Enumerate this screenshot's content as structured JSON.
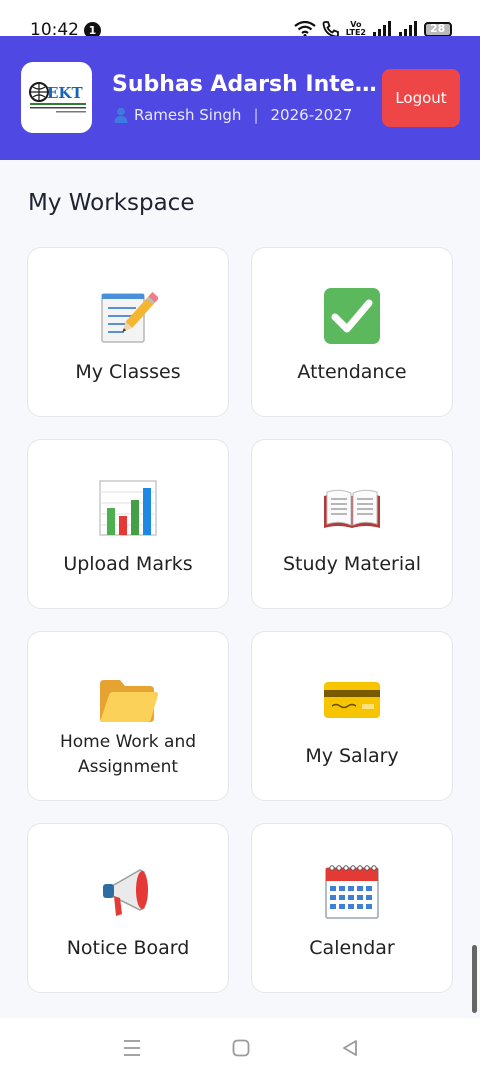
{
  "status_bar": {
    "time": "10:42",
    "notification_count": "1",
    "volte_top": "Vo",
    "volte_bottom": "LTE2",
    "battery": "28"
  },
  "header": {
    "school_name": "Subhas Adarsh Inter C...",
    "user_name": "Ramesh Singh",
    "session": "2026-2027",
    "logout_label": "Logout",
    "logo_text": "EKT",
    "colors": {
      "header_bg": "#4f48e2",
      "logout_bg": "#ee4646"
    }
  },
  "workspace": {
    "title": "My Workspace",
    "cards": [
      {
        "label": "My Classes",
        "icon": "memo-pencil-icon"
      },
      {
        "label": "Attendance",
        "icon": "check-mark-icon"
      },
      {
        "label": "Upload Marks",
        "icon": "bar-chart-icon"
      },
      {
        "label": "Study Material",
        "icon": "open-book-icon"
      },
      {
        "label": "Home Work and Assignment",
        "icon": "folder-icon"
      },
      {
        "label": "My Salary",
        "icon": "credit-card-icon"
      },
      {
        "label": "Notice Board",
        "icon": "megaphone-icon"
      },
      {
        "label": "Calendar",
        "icon": "calendar-icon"
      }
    ]
  }
}
